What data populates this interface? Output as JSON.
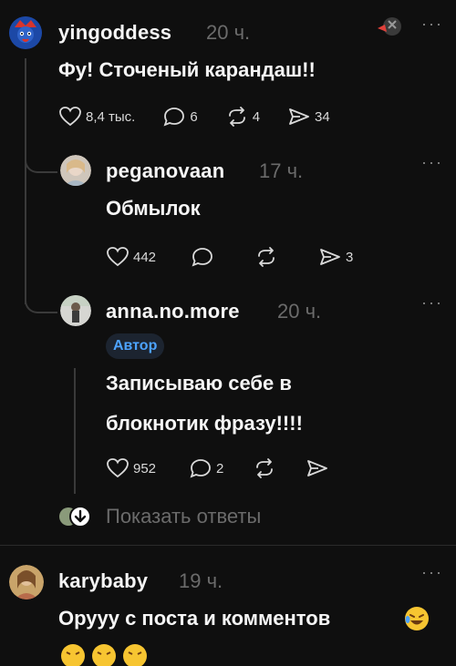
{
  "comments": [
    {
      "username": "yingoddess",
      "time": "20 ч.",
      "text": "Фу! Сточеный карандаш!!",
      "likes": "8,4 тыс.",
      "replies": "6",
      "reposts": "4",
      "shares": "34"
    },
    {
      "username": "peganovaan",
      "time": "17 ч.",
      "text": "Обмылок",
      "likes": "442",
      "shares": "3"
    },
    {
      "username": "anna.no.more",
      "time": "20 ч.",
      "badge": "Автор",
      "text_line1": "Записываю себе в",
      "text_line2": "блокнотик фразу!!!!",
      "likes": "952",
      "replies": "2"
    },
    {
      "username": "karybaby",
      "time": "19 ч.",
      "text": "Орууу с поста и комментов"
    }
  ],
  "show_replies_label": "Показать ответы",
  "more_glyph": "···",
  "colors": {
    "accent": "#4da3ff",
    "muted": "#6b6b6b",
    "background": "#0f0f0f"
  }
}
